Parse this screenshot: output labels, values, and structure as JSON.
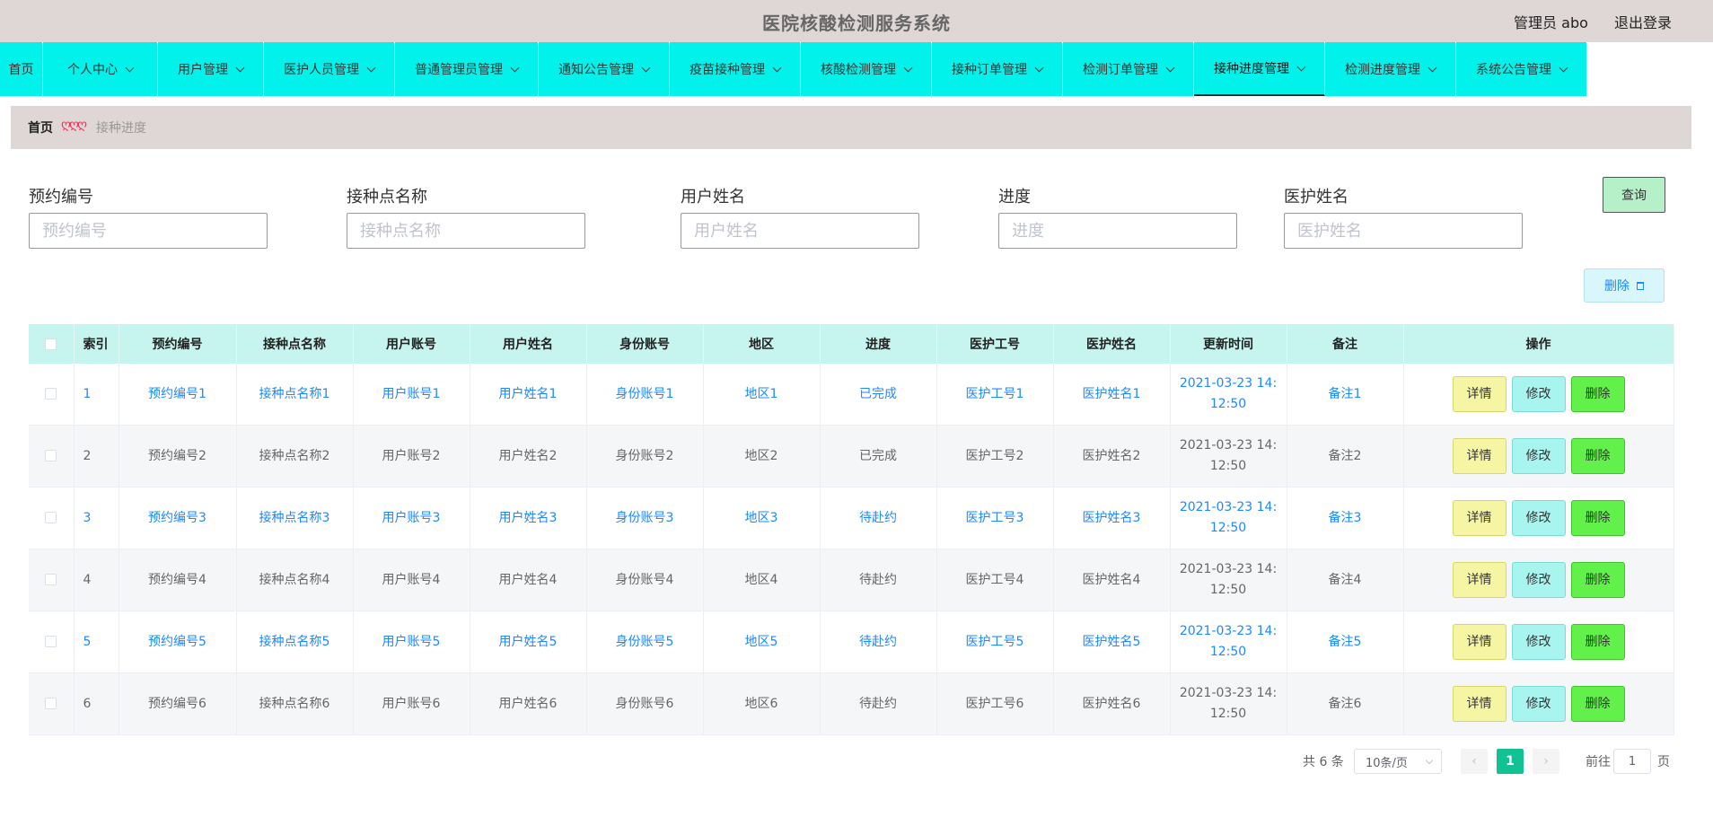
{
  "header": {
    "system_title": "医院核酸检测服务系统",
    "user_label": "管理员 abo",
    "logout_label": "退出登录"
  },
  "nav": {
    "items": [
      {
        "label": "首页",
        "has_menu": false
      },
      {
        "label": "个人中心",
        "has_menu": true
      },
      {
        "label": "用户管理",
        "has_menu": true
      },
      {
        "label": "医护人员管理",
        "has_menu": true
      },
      {
        "label": "普通管理员管理",
        "has_menu": true
      },
      {
        "label": "通知公告管理",
        "has_menu": true
      },
      {
        "label": "疫苗接种管理",
        "has_menu": true
      },
      {
        "label": "核酸检测管理",
        "has_menu": true
      },
      {
        "label": "接种订单管理",
        "has_menu": true
      },
      {
        "label": "检测订单管理",
        "has_menu": true
      },
      {
        "label": "接种进度管理",
        "has_menu": true,
        "active": true
      },
      {
        "label": "检测进度管理",
        "has_menu": true
      },
      {
        "label": "系统公告管理",
        "has_menu": true
      }
    ]
  },
  "breadcrumb": {
    "home": "首页",
    "separator": "ღღღ",
    "current": "接种进度"
  },
  "search": {
    "fields": [
      {
        "label": "预约编号",
        "placeholder": "预约编号",
        "value": ""
      },
      {
        "label": "接种点名称",
        "placeholder": "接种点名称",
        "value": ""
      },
      {
        "label": "用户姓名",
        "placeholder": "用户姓名",
        "value": ""
      },
      {
        "label": "进度",
        "placeholder": "进度",
        "value": ""
      },
      {
        "label": "医护姓名",
        "placeholder": "医护姓名",
        "value": ""
      }
    ],
    "query_label": "查询"
  },
  "toolbar": {
    "delete_label": "删除"
  },
  "table": {
    "columns": [
      "索引",
      "预约编号",
      "接种点名称",
      "用户账号",
      "用户姓名",
      "身份账号",
      "地区",
      "进度",
      "医护工号",
      "医护姓名",
      "更新时间",
      "备注",
      "操作"
    ],
    "rows": [
      {
        "index": "1",
        "booking_no": "预约编号1",
        "site": "接种点名称1",
        "account": "用户账号1",
        "name": "用户姓名1",
        "id_no": "身份账号1",
        "region": "地区1",
        "progress": "已完成",
        "staff_no": "医护工号1",
        "staff_name": "医护姓名1",
        "updated_date": "2021-03-23 14:",
        "updated_time": "12:50",
        "note": "备注1"
      },
      {
        "index": "2",
        "booking_no": "预约编号2",
        "site": "接种点名称2",
        "account": "用户账号2",
        "name": "用户姓名2",
        "id_no": "身份账号2",
        "region": "地区2",
        "progress": "已完成",
        "staff_no": "医护工号2",
        "staff_name": "医护姓名2",
        "updated_date": "2021-03-23 14:",
        "updated_time": "12:50",
        "note": "备注2"
      },
      {
        "index": "3",
        "booking_no": "预约编号3",
        "site": "接种点名称3",
        "account": "用户账号3",
        "name": "用户姓名3",
        "id_no": "身份账号3",
        "region": "地区3",
        "progress": "待赴约",
        "staff_no": "医护工号3",
        "staff_name": "医护姓名3",
        "updated_date": "2021-03-23 14:",
        "updated_time": "12:50",
        "note": "备注3"
      },
      {
        "index": "4",
        "booking_no": "预约编号4",
        "site": "接种点名称4",
        "account": "用户账号4",
        "name": "用户姓名4",
        "id_no": "身份账号4",
        "region": "地区4",
        "progress": "待赴约",
        "staff_no": "医护工号4",
        "staff_name": "医护姓名4",
        "updated_date": "2021-03-23 14:",
        "updated_time": "12:50",
        "note": "备注4"
      },
      {
        "index": "5",
        "booking_no": "预约编号5",
        "site": "接种点名称5",
        "account": "用户账号5",
        "name": "用户姓名5",
        "id_no": "身份账号5",
        "region": "地区5",
        "progress": "待赴约",
        "staff_no": "医护工号5",
        "staff_name": "医护姓名5",
        "updated_date": "2021-03-23 14:",
        "updated_time": "12:50",
        "note": "备注5"
      },
      {
        "index": "6",
        "booking_no": "预约编号6",
        "site": "接种点名称6",
        "account": "用户账号6",
        "name": "用户姓名6",
        "id_no": "身份账号6",
        "region": "地区6",
        "progress": "待赴约",
        "staff_no": "医护工号6",
        "staff_name": "医护姓名6",
        "updated_date": "2021-03-23 14:",
        "updated_time": "12:50",
        "note": "备注6"
      }
    ],
    "actions": {
      "detail": "详情",
      "edit": "修改",
      "delete": "删除"
    }
  },
  "pagination": {
    "total_text": "共 6 条",
    "page_size": "10条/页",
    "current_page": "1",
    "goto_label": "前往",
    "goto_value": "1",
    "page_suffix": "页",
    "prev_icon": "‹",
    "next_icon": "›"
  },
  "colors": {
    "nav_bg": "#00f2ea",
    "header_bg": "#dfd6d6",
    "table_head_bg": "#c6f4ef",
    "link_blue": "#1e88ff",
    "pager_active": "#13c293"
  }
}
